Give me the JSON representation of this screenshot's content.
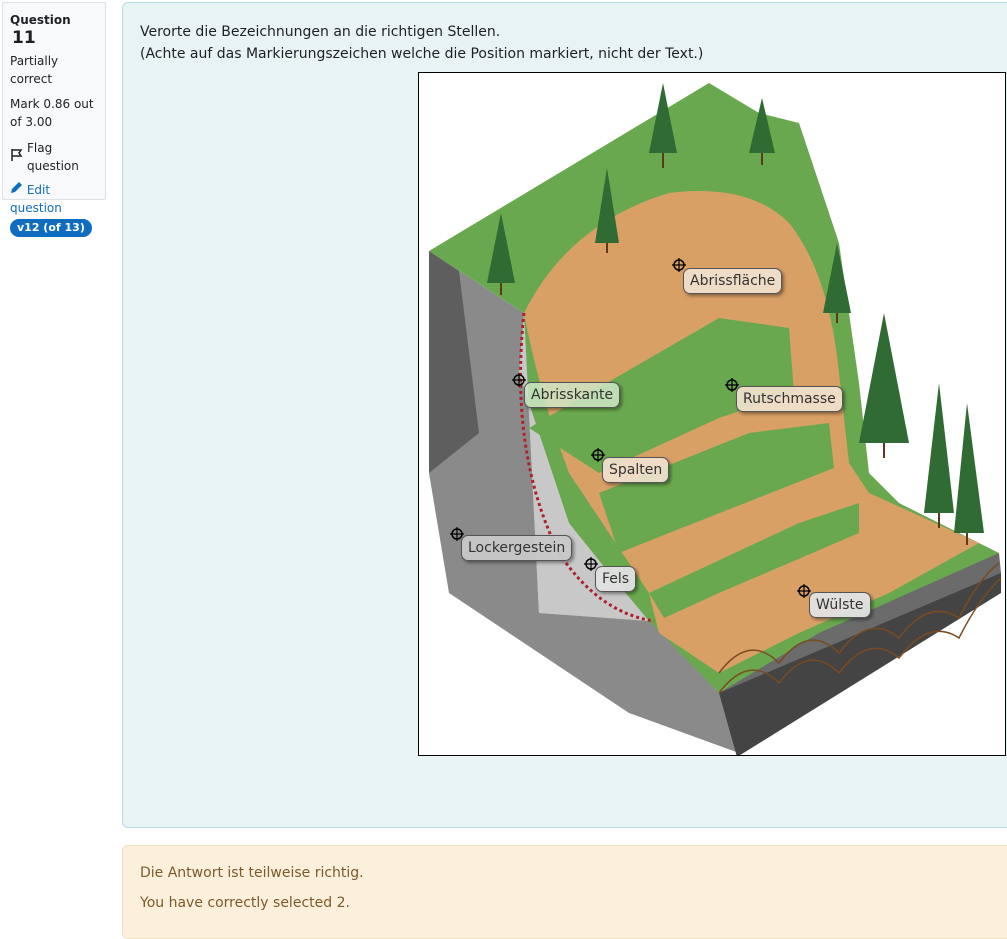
{
  "info": {
    "question_prefix": "Question",
    "question_number": "11",
    "state": "Partially correct",
    "mark": "Mark 0.86 out of 3.00",
    "flag_label": "Flag question",
    "edit_label": "Edit question",
    "version_badge": "v12 (of 13)"
  },
  "question": {
    "line1": "Verorte die Bezeichnungen an die richtigen Stellen.",
    "line2": "(Achte auf das Markierungszeichen welche die Position markiert, nicht der Text.)"
  },
  "labels": {
    "abrissflaeche": "Abrissfläche",
    "abrisskante": "Abrisskante",
    "rutschmasse": "Rutschmasse",
    "spalten": "Spalten",
    "lockergestein": "Lockergestein",
    "fels": "Fels",
    "wulste": "Wülste"
  },
  "feedback": {
    "line1": "Die Antwort ist teilweise richtig.",
    "line2": "You have correctly selected 2."
  },
  "colors": {
    "accent": "#0f6cbf",
    "grass": "#6aa84f",
    "earth": "#d9a066",
    "rock": "#8c8c8c"
  }
}
